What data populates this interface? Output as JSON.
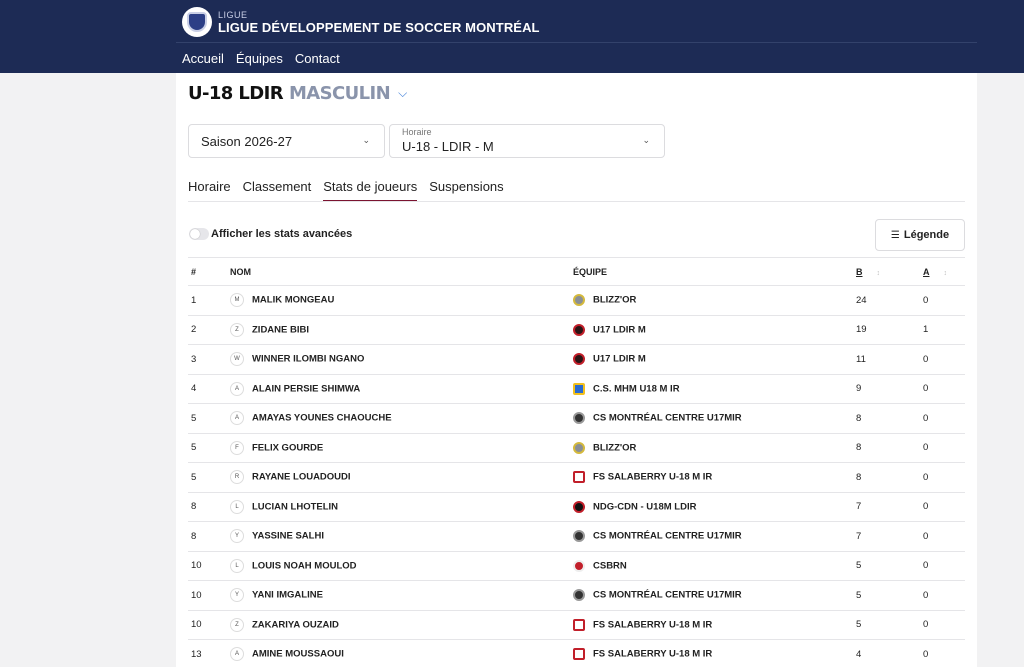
{
  "header": {
    "brand_small": "LIGUE",
    "brand_title": "LIGUE DÉVELOPPEMENT DE SOCCER MONTRÉAL",
    "nav": [
      "Accueil",
      "Équipes",
      "Contact"
    ]
  },
  "page": {
    "title": "U-18 LDIR",
    "subtitle": "MASCULIN",
    "season_value": "Saison 2026-27",
    "schedule_label": "Horaire",
    "schedule_value": "U-18 - LDIR - M",
    "tabs": [
      "Horaire",
      "Classement",
      "Stats de joueurs",
      "Suspensions"
    ],
    "active_tab": "Stats de joueurs",
    "toggle_label": "Afficher les stats avancées",
    "legend_label": "Légende"
  },
  "table": {
    "headers": {
      "rank": "#",
      "name": "NOM",
      "team": "ÉQUIPE",
      "b": "B",
      "a": "A"
    },
    "rows": [
      {
        "rank": "1",
        "initial": "M",
        "name": "MALIK MONGEAU",
        "crest": "blizz",
        "team": "BLIZZ'OR",
        "b": "24",
        "a": "0"
      },
      {
        "rank": "2",
        "initial": "Z",
        "name": "ZIDANE BIBI",
        "crest": "u17",
        "team": "U17 LDIR M",
        "b": "19",
        "a": "1"
      },
      {
        "rank": "3",
        "initial": "W",
        "name": "WINNER ILOMBI NGANO",
        "crest": "u17",
        "team": "U17 LDIR M",
        "b": "11",
        "a": "0"
      },
      {
        "rank": "4",
        "initial": "A",
        "name": "ALAIN PERSIE SHIMWA",
        "crest": "mhm",
        "team": "C.S. MHM U18 M IR",
        "b": "9",
        "a": "0"
      },
      {
        "rank": "5",
        "initial": "A",
        "name": "AMAYAS YOUNES CHAOUCHE",
        "crest": "csmc",
        "team": "CS MONTRÉAL CENTRE U17MIR",
        "b": "8",
        "a": "0"
      },
      {
        "rank": "5",
        "initial": "F",
        "name": "FELIX GOURDE",
        "crest": "blizz",
        "team": "BLIZZ'OR",
        "b": "8",
        "a": "0"
      },
      {
        "rank": "5",
        "initial": "R",
        "name": "RAYANE LOUADOUDI",
        "crest": "fss",
        "team": "FS SALABERRY U-18 M IR",
        "b": "8",
        "a": "0"
      },
      {
        "rank": "8",
        "initial": "L",
        "name": "LUCIAN LHOTELIN",
        "crest": "ndg",
        "team": "NDG-CDN - U18M LDIR",
        "b": "7",
        "a": "0"
      },
      {
        "rank": "8",
        "initial": "Y",
        "name": "YASSINE SALHI",
        "crest": "csmc",
        "team": "CS MONTRÉAL CENTRE U17MIR",
        "b": "7",
        "a": "0"
      },
      {
        "rank": "10",
        "initial": "L",
        "name": "LOUIS NOAH MOULOD",
        "crest": "csbrn",
        "team": "CSBRN",
        "b": "5",
        "a": "0"
      },
      {
        "rank": "10",
        "initial": "Y",
        "name": "YANI IMGALINE",
        "crest": "csmc",
        "team": "CS MONTRÉAL CENTRE U17MIR",
        "b": "5",
        "a": "0"
      },
      {
        "rank": "10",
        "initial": "Z",
        "name": "ZAKARIYA OUZAID",
        "crest": "fss",
        "team": "FS SALABERRY U-18 M IR",
        "b": "5",
        "a": "0"
      },
      {
        "rank": "13",
        "initial": "A",
        "name": "AMINE MOUSSAOUI",
        "crest": "fss",
        "team": "FS SALABERRY U-18 M IR",
        "b": "4",
        "a": "0"
      }
    ]
  }
}
